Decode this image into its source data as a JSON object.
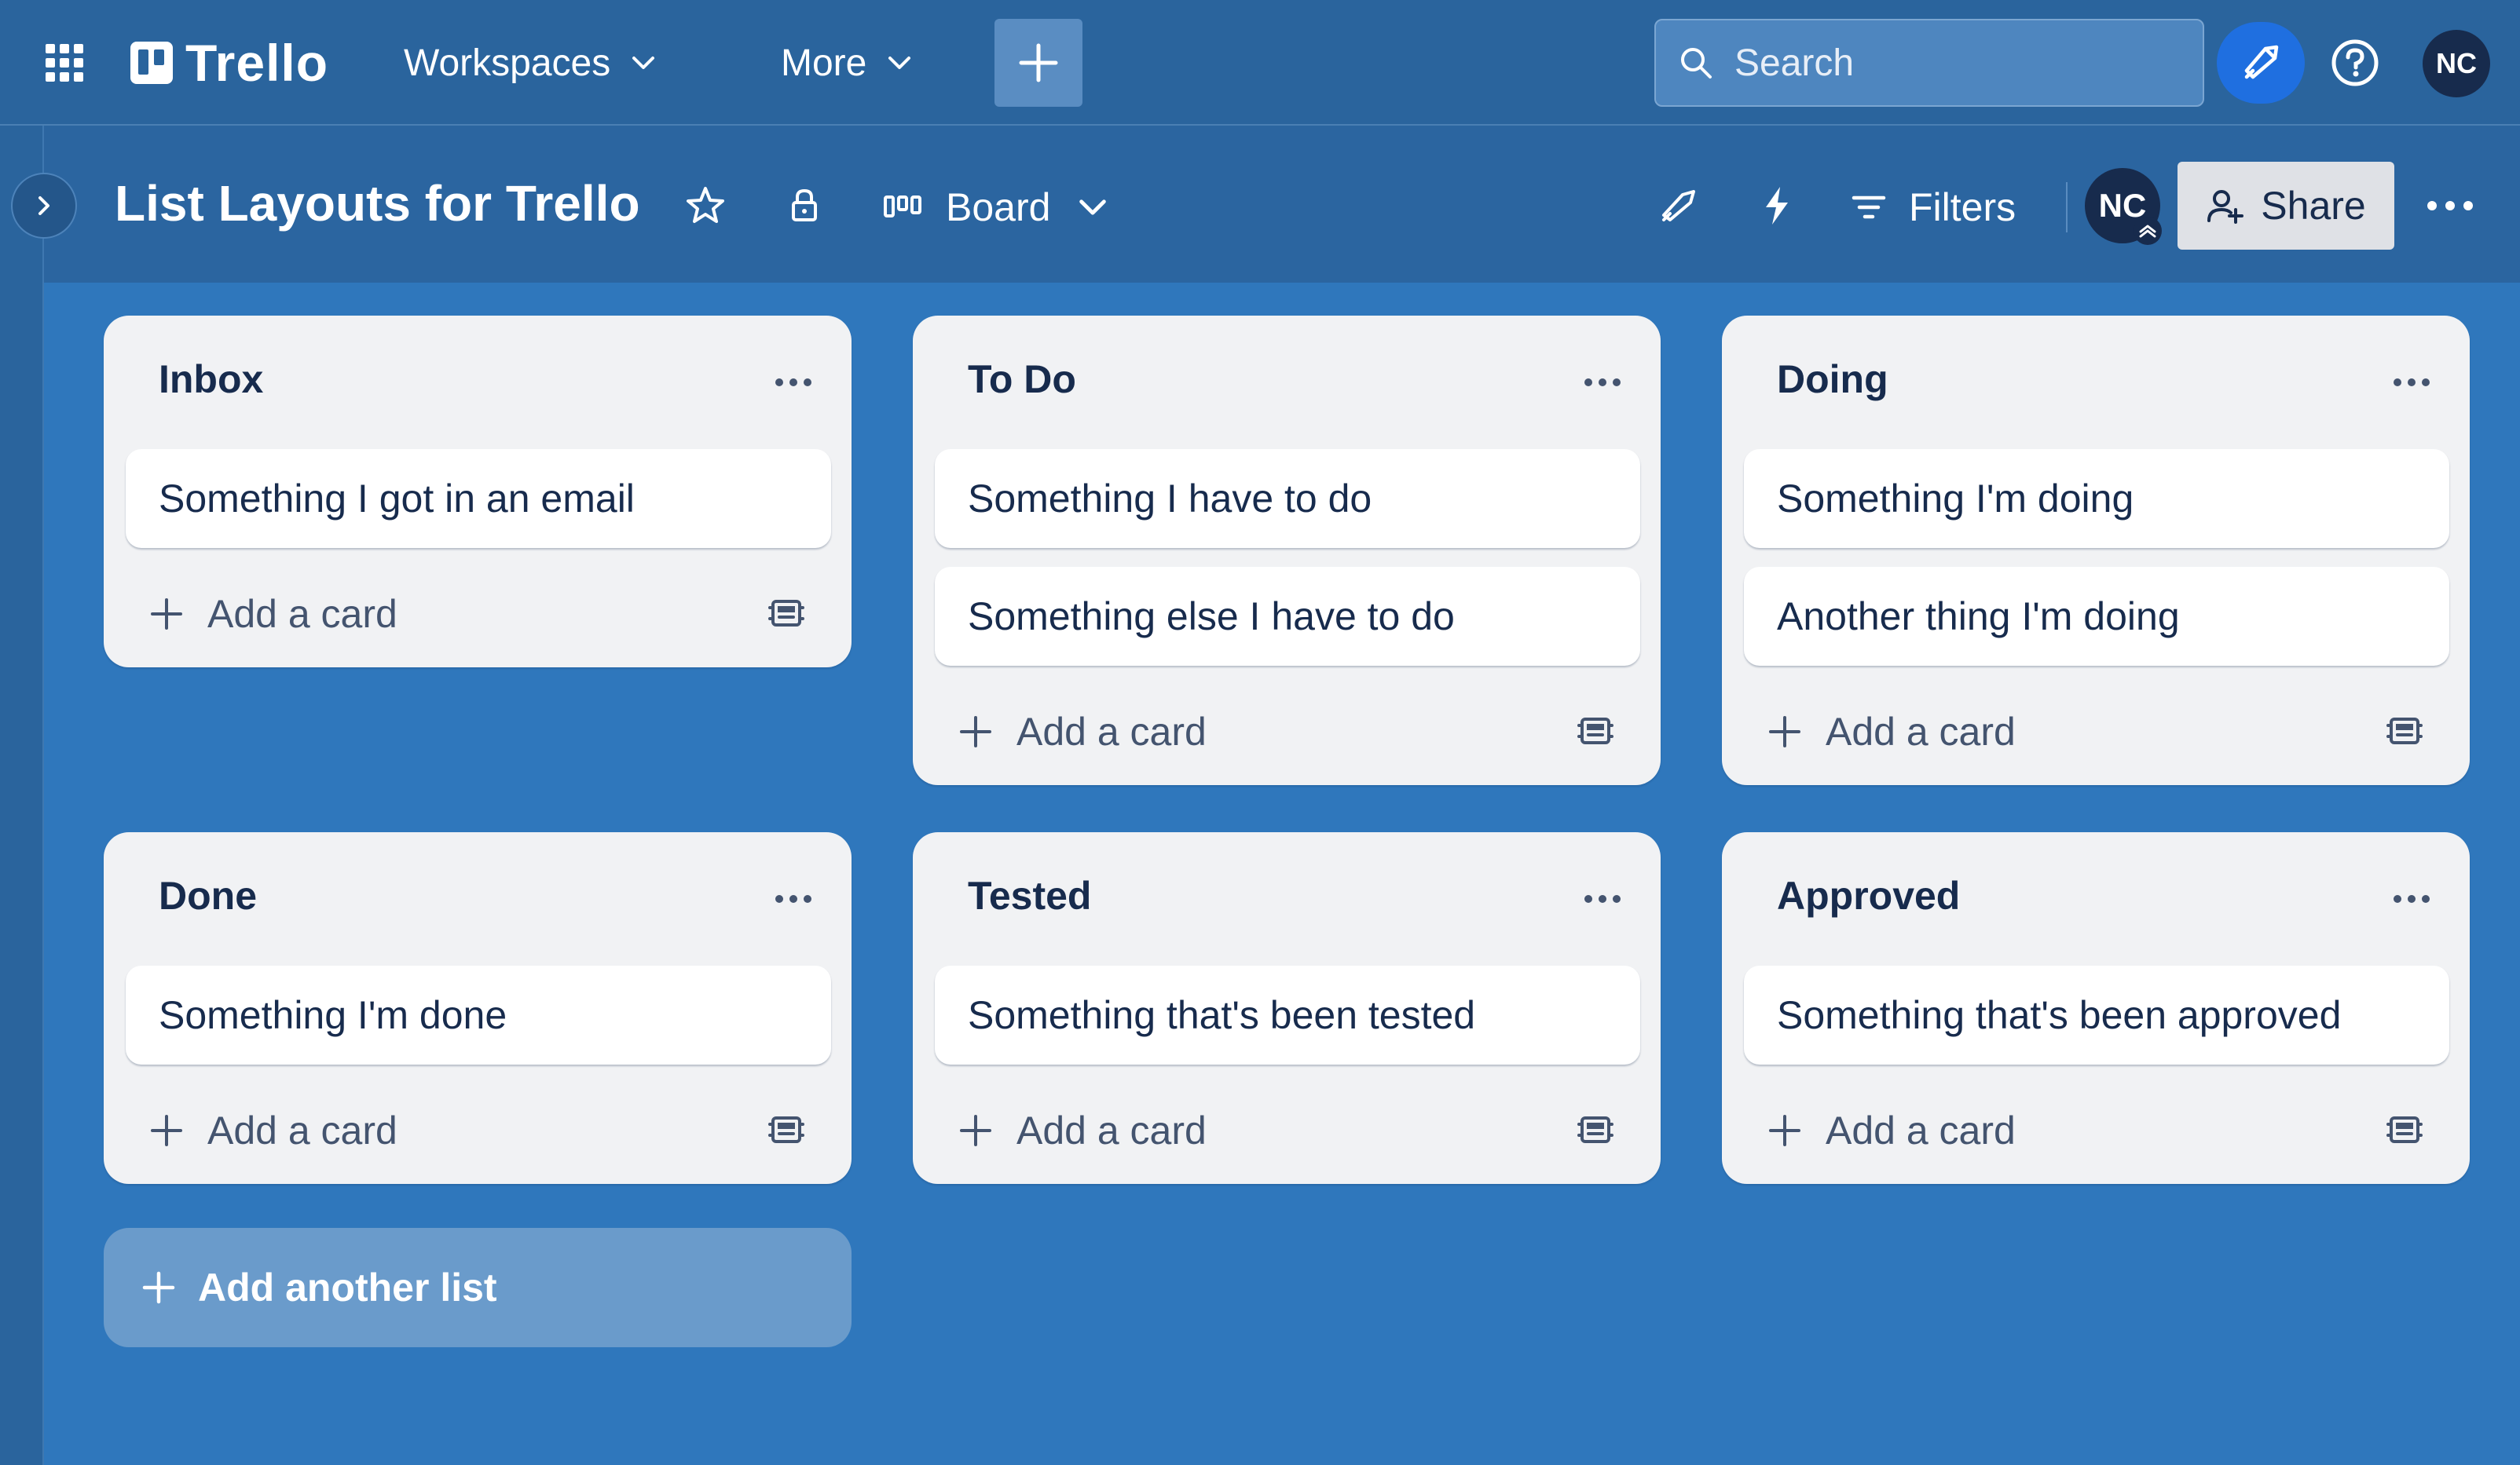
{
  "topnav": {
    "logo_text": "Trello",
    "workspaces_label": "Workspaces",
    "more_label": "More",
    "search_placeholder": "Search",
    "avatar_initials": "NC"
  },
  "board": {
    "title": "List Layouts for Trello",
    "view_label": "Board",
    "filters_label": "Filters",
    "member_initials": "NC",
    "share_label": "Share"
  },
  "lists": [
    {
      "title": "Inbox",
      "cards": [
        "Something I got in an email"
      ],
      "add_label": "Add a card"
    },
    {
      "title": "To Do",
      "cards": [
        "Something I have to do",
        "Something else I have to do"
      ],
      "add_label": "Add a card"
    },
    {
      "title": "Doing",
      "cards": [
        "Something I'm doing",
        "Another thing I'm doing"
      ],
      "add_label": "Add a card"
    },
    {
      "title": "Done",
      "cards": [
        "Something I'm done"
      ],
      "add_label": "Add a card"
    },
    {
      "title": "Tested",
      "cards": [
        "Something that's been tested"
      ],
      "add_label": "Add a card"
    },
    {
      "title": "Approved",
      "cards": [
        "Something that's been approved"
      ],
      "add_label": "Add a card"
    }
  ],
  "add_list_label": "Add another list",
  "colors": {
    "board_bg": "#2f77bc",
    "nav_bg": "#2a649d",
    "list_bg": "#f1f2f4",
    "avatar_bg": "#172b4d",
    "notification_accent": "#1f6fe0"
  }
}
